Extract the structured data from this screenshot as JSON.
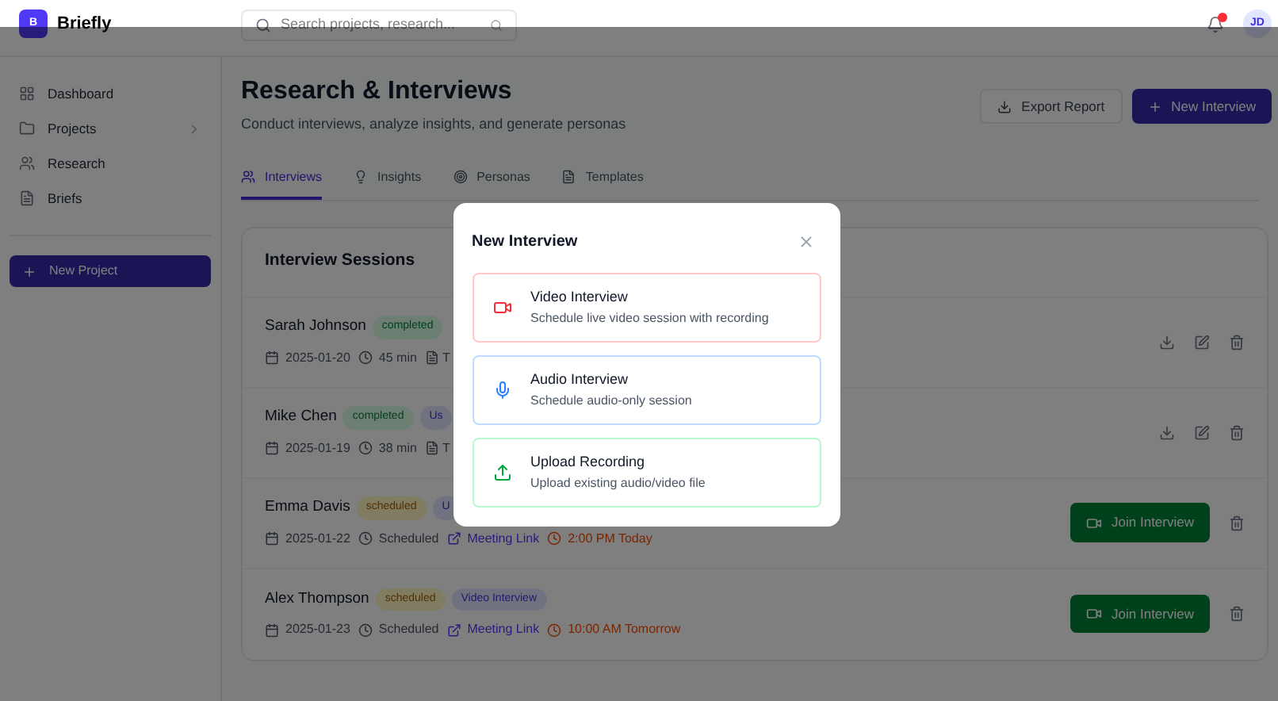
{
  "brand": {
    "logo": "B",
    "name": "Briefly"
  },
  "search": {
    "placeholder": "Search projects, research..."
  },
  "notifications": {
    "unread": true
  },
  "user": {
    "initials": "JD"
  },
  "sidebar": {
    "items": [
      {
        "label": "Dashboard",
        "expandable": false
      },
      {
        "label": "Projects",
        "expandable": true
      },
      {
        "label": "Research",
        "expandable": false
      },
      {
        "label": "Briefs",
        "expandable": false
      }
    ],
    "new_project": "New Project"
  },
  "page": {
    "title": "Research & Interviews",
    "subtitle": "Conduct interviews, analyze insights, and generate personas",
    "export": "Export Report",
    "new_interview": "New Interview"
  },
  "tabs": [
    {
      "label": "Interviews",
      "selected": true
    },
    {
      "label": "Insights",
      "selected": false
    },
    {
      "label": "Personas",
      "selected": false
    },
    {
      "label": "Templates",
      "selected": false
    }
  ],
  "sessions": {
    "title": "Interview Sessions",
    "rows": [
      {
        "name": "Sarah Johnson",
        "status": "completed",
        "date": "2025-01-20",
        "duration": "45 min",
        "extra": "T"
      },
      {
        "name": "Mike Chen",
        "status": "completed",
        "type": "Us",
        "date": "2025-01-19",
        "duration": "38 min",
        "extra": "T"
      },
      {
        "name": "Emma Davis",
        "status": "scheduled",
        "type": "U",
        "date": "2025-01-22",
        "duration": "Scheduled",
        "link": "Meeting Link",
        "time": "2:00 PM Today",
        "join": "Join Interview"
      },
      {
        "name": "Alex Thompson",
        "status": "scheduled",
        "type": "Video Interview",
        "date": "2025-01-23",
        "duration": "Scheduled",
        "link": "Meeting Link",
        "time": "10:00 AM Tomorrow",
        "join": "Join Interview"
      }
    ]
  },
  "modal": {
    "title": "New Interview",
    "options": [
      {
        "kind": "video",
        "title": "Video Interview",
        "description": "Schedule live video session with recording"
      },
      {
        "kind": "audio",
        "title": "Audio Interview",
        "description": "Schedule audio-only session"
      },
      {
        "kind": "upload",
        "title": "Upload Recording",
        "description": "Upload existing audio/video file"
      }
    ]
  }
}
